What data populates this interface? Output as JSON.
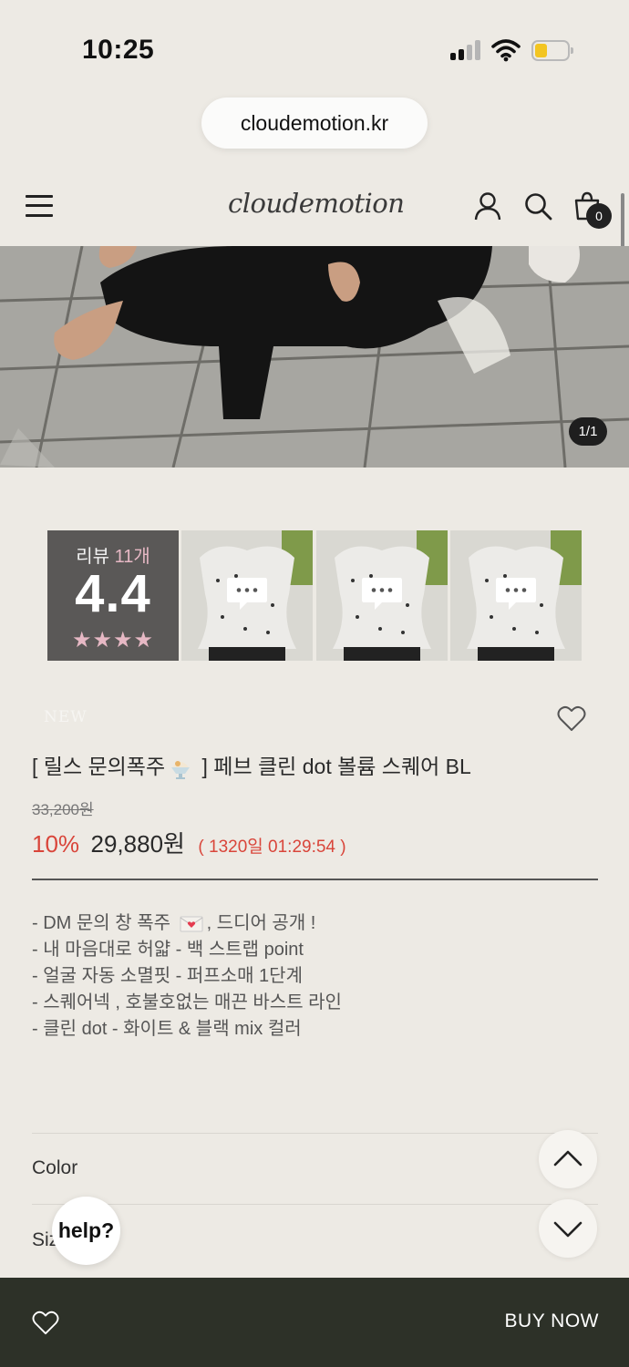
{
  "status_bar": {
    "time": "10:25",
    "battery_color": "#f3c521"
  },
  "browser": {
    "url": "cloudemotion.kr"
  },
  "header": {
    "logo": "cloudemotion",
    "cart_count": "0",
    "icons": [
      "menu-icon",
      "user-icon",
      "search-icon",
      "cart-icon"
    ]
  },
  "gallery": {
    "counter": "1/1"
  },
  "reviews": {
    "label_prefix": "리뷰 ",
    "count": "11개",
    "score": "4.4",
    "stars": "★★★★"
  },
  "product": {
    "badge": "NEW",
    "title_prefix": "[ 릴스 문의폭주",
    "title_suffix": " ] 페브 클린 dot 볼륨 스퀘어 BL",
    "original_price": "33,200원",
    "discount": "10%",
    "sale_price": "29,880원",
    "timer": "( 1320일 01:29:54 )",
    "description": [
      "- DM 문의 창 폭주",
      ", 드디어 공개 !",
      "- 내 마음대로 허얇 - 백 스트랩 point",
      "- 얼굴 자동 소멸핏 - 퍼프소매 1단계",
      "- 스퀘어넥 , 호불호없는 매끈 바스트 라인",
      "- 클린 dot - 화이트 & 블랙 mix 컬러"
    ]
  },
  "options": {
    "color_label": "Color",
    "size_label": "Size",
    "arrow": "⌄"
  },
  "help": {
    "label": "help?"
  },
  "bottom_bar": {
    "buy_label": "BUY NOW"
  },
  "colors": {
    "background": "#edeae4",
    "accent_red": "#d9453a",
    "bottom_bar": "#2d3128"
  }
}
